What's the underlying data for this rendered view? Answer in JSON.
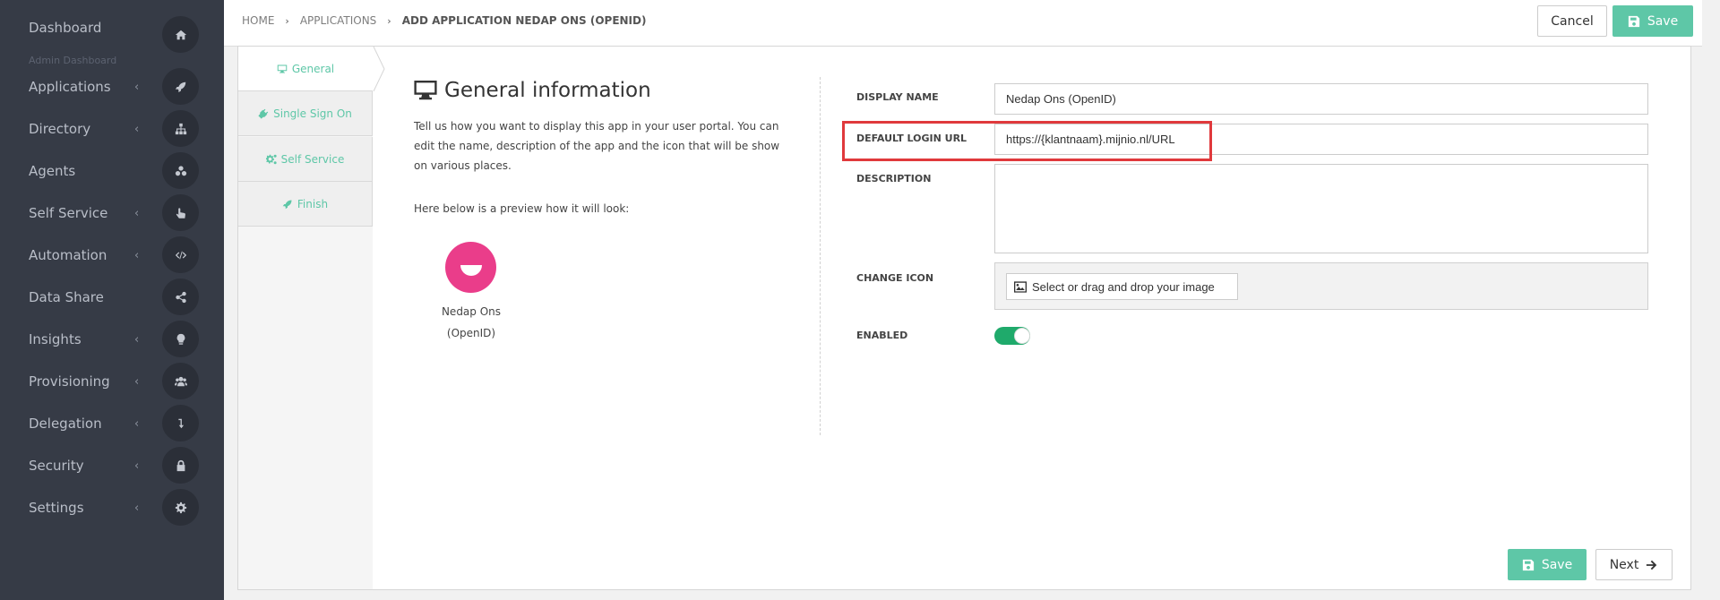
{
  "sidebar": {
    "items": [
      {
        "label": "Dashboard",
        "sub": "Admin Dashboard",
        "icon": "home-icon",
        "chevron": false
      },
      {
        "label": "Applications",
        "icon": "rocket-icon",
        "chevron": true
      },
      {
        "label": "Directory",
        "icon": "sitemap-icon",
        "chevron": true
      },
      {
        "label": "Agents",
        "icon": "cubes-icon",
        "chevron": false
      },
      {
        "label": "Self Service",
        "icon": "hand-pointer-icon",
        "chevron": true
      },
      {
        "label": "Automation",
        "icon": "code-icon",
        "chevron": true
      },
      {
        "label": "Data Share",
        "icon": "share-icon",
        "chevron": false
      },
      {
        "label": "Insights",
        "icon": "lightbulb-icon",
        "chevron": true
      },
      {
        "label": "Provisioning",
        "icon": "users-icon",
        "chevron": true
      },
      {
        "label": "Delegation",
        "icon": "level-down-icon",
        "chevron": true
      },
      {
        "label": "Security",
        "icon": "lock-icon",
        "chevron": true
      },
      {
        "label": "Settings",
        "icon": "gear-icon",
        "chevron": true
      }
    ],
    "chevron_glyph": "‹"
  },
  "breadcrumb": {
    "home": "HOME",
    "applications": "APPLICATIONS",
    "current": "ADD APPLICATION NEDAP ONS (OPENID)",
    "separator": "›"
  },
  "toolbar": {
    "cancel_label": "Cancel",
    "save_label": "Save"
  },
  "wizard": {
    "steps": [
      {
        "label": "General",
        "icon": "desktop-icon"
      },
      {
        "label": "Single Sign On",
        "icon": "plug-icon"
      },
      {
        "label": "Self Service",
        "icon": "cogs-icon"
      },
      {
        "label": "Finish",
        "icon": "rocket-icon"
      }
    ],
    "active_step": 0
  },
  "general": {
    "title": "General information",
    "description": "Tell us how you want to display this app in your user portal. You can edit the name, description of the app and the icon that will be show on various places.",
    "preview_text": "Here below is a preview how it will look:",
    "app_name_line1": "Nedap Ons",
    "app_name_line2": "(OpenID)"
  },
  "form": {
    "display_name_label": "DISPLAY NAME",
    "display_name_value": "Nedap Ons (OpenID)",
    "login_url_label": "DEFAULT LOGIN URL",
    "login_url_value": "https://{klantnaam}.mijnio.nl/URL",
    "description_label": "DESCRIPTION",
    "description_value": "",
    "change_icon_label": "CHANGE ICON",
    "change_icon_button": "Select or drag and drop your image",
    "enabled_label": "ENABLED",
    "enabled": true
  },
  "footer": {
    "save_label": "Save",
    "next_label": "Next"
  },
  "colors": {
    "sidebar_bg": "#363b46",
    "accent": "#5ec7a7",
    "toggle_on": "#1faa6b",
    "app_logo": "#ea3d8a",
    "highlight": "#e0393c"
  }
}
